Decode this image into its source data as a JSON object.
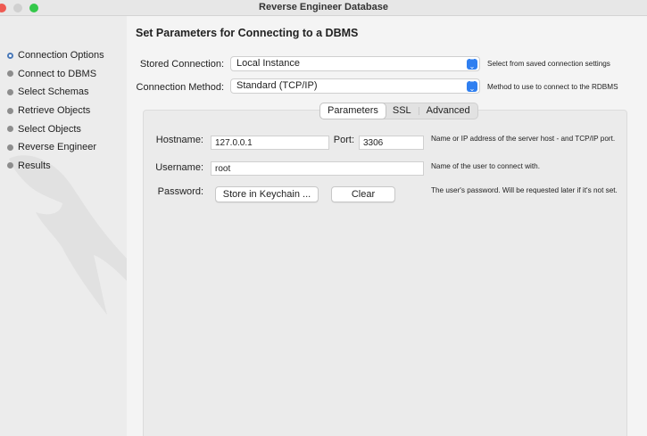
{
  "window": {
    "title": "Reverse Engineer Database"
  },
  "sidebar": {
    "steps": [
      {
        "label": "Connection Options",
        "active": true
      },
      {
        "label": "Connect to DBMS"
      },
      {
        "label": "Select Schemas"
      },
      {
        "label": "Retrieve Objects"
      },
      {
        "label": "Select Objects"
      },
      {
        "label": "Reverse Engineer"
      },
      {
        "label": "Results"
      }
    ]
  },
  "main": {
    "title": "Set Parameters for Connecting to a DBMS",
    "stored_connection": {
      "label": "Stored Connection:",
      "value": "Local Instance",
      "hint": "Select from saved connection settings"
    },
    "connection_method": {
      "label": "Connection Method:",
      "value": "Standard (TCP/IP)",
      "hint": "Method to use to connect to the RDBMS"
    },
    "tabs": [
      "Parameters",
      "SSL",
      "Advanced"
    ],
    "params": {
      "hostname": {
        "label": "Hostname:",
        "value": "127.0.0.1",
        "hint": "Name or IP address of the server host - and TCP/IP port."
      },
      "port": {
        "label": "Port:",
        "value": "3306"
      },
      "username": {
        "label": "Username:",
        "value": "root",
        "hint": "Name of the user to connect with."
      },
      "password": {
        "label": "Password:",
        "store_button": "Store in Keychain ...",
        "clear_button": "Clear",
        "hint": "The user's password. Will be requested later if it's not set."
      }
    }
  },
  "colors": {
    "accent": "#2f7ff0",
    "close": "#ee5a52",
    "maximize": "#34c84a",
    "active_step": "#4a79b8"
  }
}
